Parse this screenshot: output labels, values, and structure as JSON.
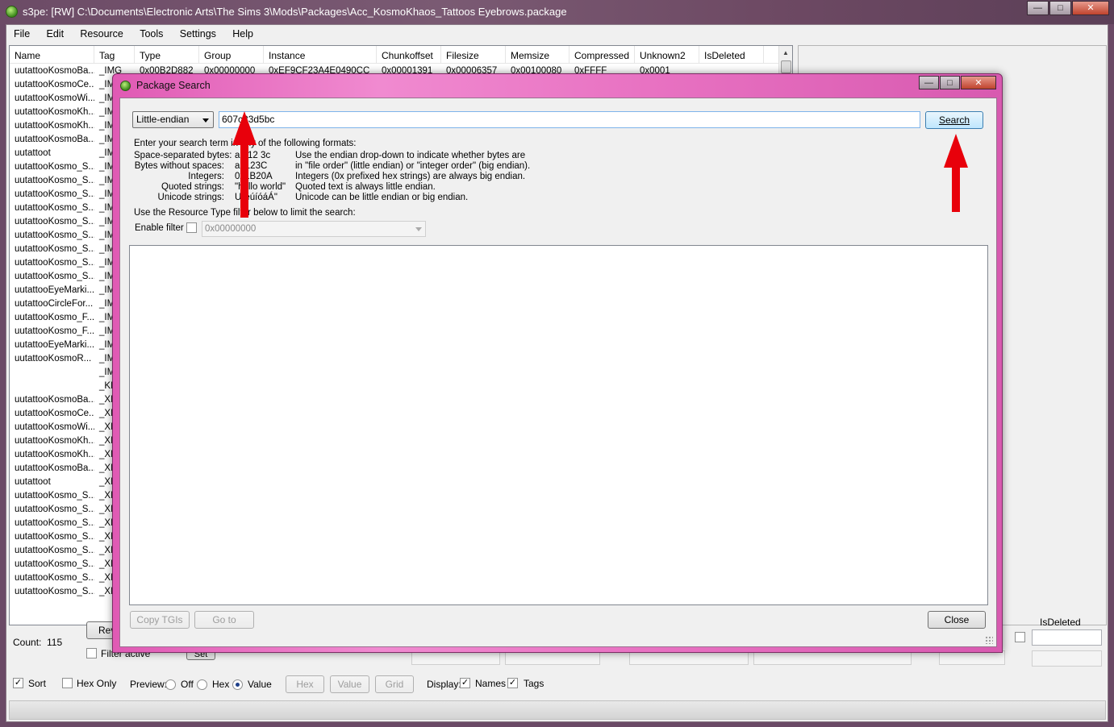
{
  "window": {
    "title": "s3pe: [RW] C:\\Documents\\Electronic Arts\\The Sims 3\\Mods\\Packages\\Acc_KosmoKhaos_Tattoos Eyebrows.package"
  },
  "menu": {
    "file": "File",
    "edit": "Edit",
    "resource": "Resource",
    "tools": "Tools",
    "settings": "Settings",
    "help": "Help"
  },
  "list": {
    "columns": [
      "Name",
      "Tag",
      "Type",
      "Group",
      "Instance",
      "Chunkoffset",
      "Filesize",
      "Memsize",
      "Compressed",
      "Unknown2",
      "IsDeleted"
    ],
    "first_row": [
      "uutattooKosmoBa...",
      "_IMG",
      "0x00B2D882",
      "0x00000000",
      "0xEF9CF23A4E0490CC",
      "0x00001391",
      "0x00006357",
      "0x00100080",
      "0xFFFF",
      "0x0001",
      ""
    ],
    "rows": [
      [
        "uutattooKosmoCe...",
        "_IMG"
      ],
      [
        "uutattooKosmoWi...",
        "_IMG"
      ],
      [
        "uutattooKosmoKh...",
        "_IMG"
      ],
      [
        "uutattooKosmoKh...",
        "_IMG"
      ],
      [
        "uutattooKosmoBa...",
        "_IMG"
      ],
      [
        "uutattoot",
        "_IMG"
      ],
      [
        "uutattooKosmo_S...",
        "_IMG"
      ],
      [
        "uutattooKosmo_S...",
        "_IMG"
      ],
      [
        "uutattooKosmo_S...",
        "_IMG"
      ],
      [
        "uutattooKosmo_S...",
        "_IMG"
      ],
      [
        "uutattooKosmo_S...",
        "_IMG"
      ],
      [
        "uutattooKosmo_S...",
        "_IMG"
      ],
      [
        "uutattooKosmo_S...",
        "_IMG"
      ],
      [
        "uutattooKosmo_S...",
        "_IMG"
      ],
      [
        "uutattooKosmo_S...",
        "_IMG"
      ],
      [
        "uutattooEyeMarki...",
        "_IMG"
      ],
      [
        "uutattooCircleFor...",
        "_IMG"
      ],
      [
        "uutattooKosmo_F...",
        "_IMG"
      ],
      [
        "uutattooKosmo_F...",
        "_IMG"
      ],
      [
        "uutattooEyeMarki...",
        "_IMG"
      ],
      [
        "uutattooKosmoR...",
        "_IMG"
      ],
      [
        "",
        "_IMG"
      ],
      [
        "",
        "_KEY"
      ],
      [
        "uutattooKosmoBa...",
        "_XML"
      ],
      [
        "uutattooKosmoCe...",
        "_XML"
      ],
      [
        "uutattooKosmoWi...",
        "_XML"
      ],
      [
        "uutattooKosmoKh...",
        "_XML"
      ],
      [
        "uutattooKosmoKh...",
        "_XML"
      ],
      [
        "uutattooKosmoBa...",
        "_XML"
      ],
      [
        "uutattoot",
        "_XML"
      ],
      [
        "uutattooKosmo_S...",
        "_XML"
      ],
      [
        "uutattooKosmo_S...",
        "_XML"
      ],
      [
        "uutattooKosmo_S...",
        "_XML"
      ],
      [
        "uutattooKosmo_S...",
        "_XML"
      ],
      [
        "uutattooKosmo_S...",
        "_XML"
      ],
      [
        "uutattooKosmo_S...",
        "_XML"
      ],
      [
        "uutattooKosmo_S...",
        "_XML"
      ],
      [
        "uutattooKosmo_S...",
        "_XML"
      ]
    ]
  },
  "bottom": {
    "count_label": "Count:",
    "count_value": "115",
    "revise_button": "Revis",
    "filter_active": "Filter active",
    "set_button": "Set",
    "isdeleted_label": "IsDeleted",
    "sort": "Sort",
    "hex_only": "Hex Only",
    "preview_label": "Preview:",
    "preview_off": "Off",
    "preview_hex": "Hex",
    "preview_value": "Value",
    "hex_button": "Hex",
    "value_button": "Value",
    "grid_button": "Grid",
    "display_label": "Display:",
    "names": "Names",
    "tags": "Tags"
  },
  "dialog": {
    "title": "Package Search",
    "endian": "Little-endian",
    "search_value": "607c83d5bc",
    "search_button": "Search",
    "instructions": "Enter your search term in any of the following formats:",
    "formats": [
      {
        "label": "Space-separated bytes:",
        "example": "ab 12 3c",
        "note": "Use the endian drop-down to indicate whether bytes are"
      },
      {
        "label": "Bytes without spaces:",
        "example": "ab123C",
        "note": "in \"file order\" (little endian) or \"integer order\" (big endian)."
      },
      {
        "label": "Integers:",
        "example": "0x1B20A",
        "note": "Integers (0x prefixed hex strings) are always big endian."
      },
      {
        "label": "Quoted strings:",
        "example": "\"hello world\"",
        "note": "Quoted text is always little endian."
      },
      {
        "label": "Unicode strings:",
        "example": "U\"éúíóáÁ\"",
        "note": "Unicode can be little endian or big endian."
      }
    ],
    "filter_hint": "Use the Resource Type filter below to limit the search:",
    "enable_filter": "Enable filter",
    "filter_value": "0x00000000",
    "copy_tgis": "Copy TGIs",
    "go_to": "Go to",
    "close": "Close"
  },
  "colors": {
    "annotation_arrow": "#e8000b",
    "dialog_frame": "#ea78c8",
    "main_frame": "#6b4a66"
  }
}
